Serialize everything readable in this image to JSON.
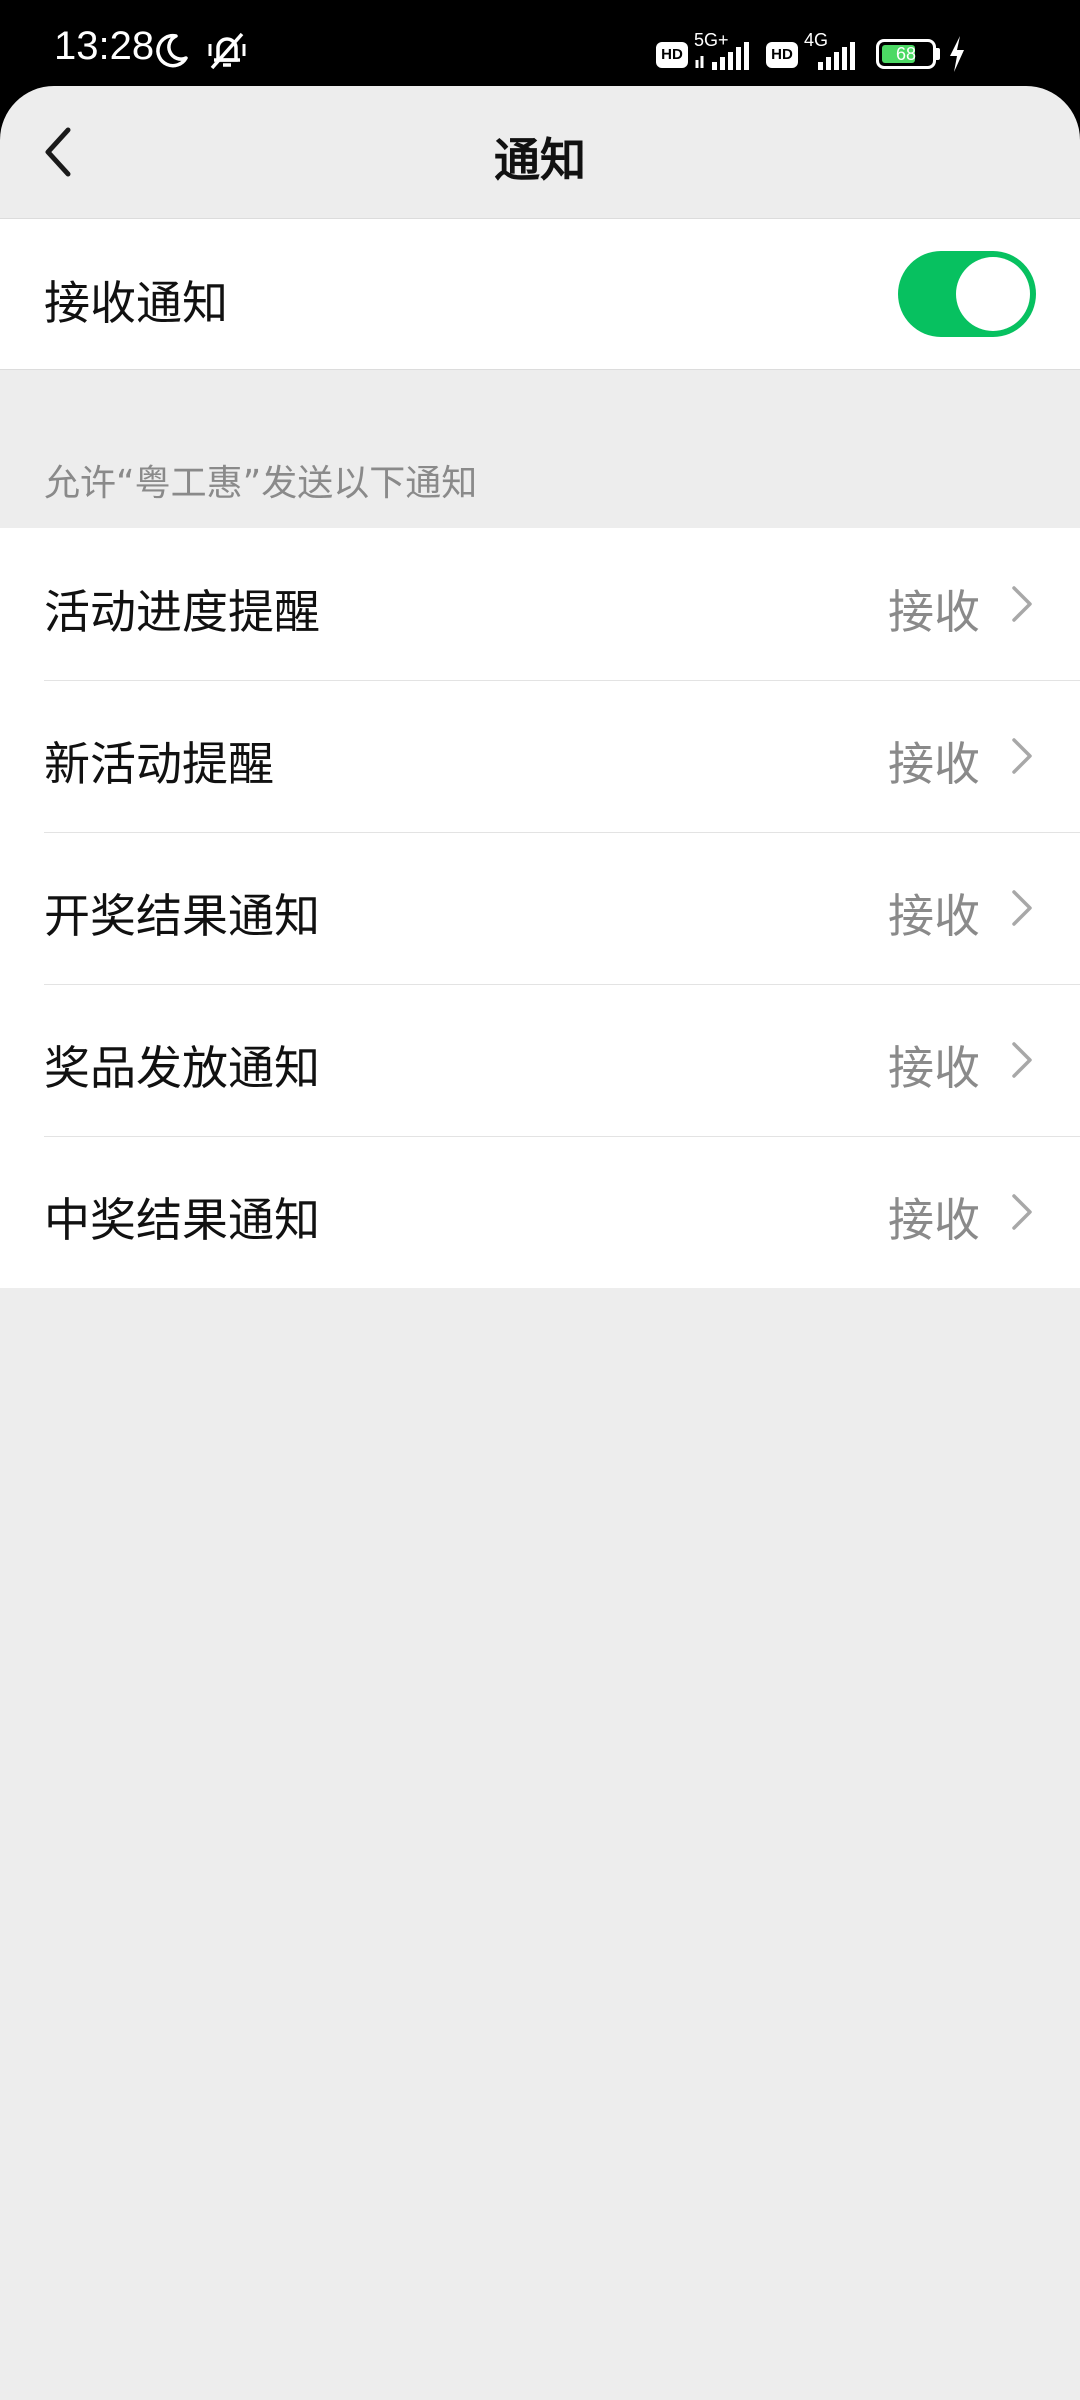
{
  "status_bar": {
    "time": "13:28",
    "icons": [
      "moon-icon",
      "bell-muted-icon",
      "hd-icon",
      "signal-5g-icon",
      "hd-icon",
      "signal-4g-icon",
      "battery-icon",
      "charging-icon"
    ],
    "hd_label": "HD",
    "net1": "5G+",
    "net2": "4G",
    "battery": "68",
    "battery_level": 0.68,
    "battery_color": "#4cd964"
  },
  "navbar": {
    "title": "通知",
    "back_icon": "chevron-left-icon"
  },
  "master": {
    "label": "接收通知",
    "enabled": true,
    "toggle_color": "#07c160"
  },
  "section": {
    "caption": "允许“粤工惠”发送以下通知"
  },
  "items": [
    {
      "label": "活动进度提醒",
      "value": "接收"
    },
    {
      "label": "新活动提醒",
      "value": "接收"
    },
    {
      "label": "开奖结果通知",
      "value": "接收"
    },
    {
      "label": "奖品发放通知",
      "value": "接收"
    },
    {
      "label": "中奖结果通知",
      "value": "接收"
    }
  ]
}
